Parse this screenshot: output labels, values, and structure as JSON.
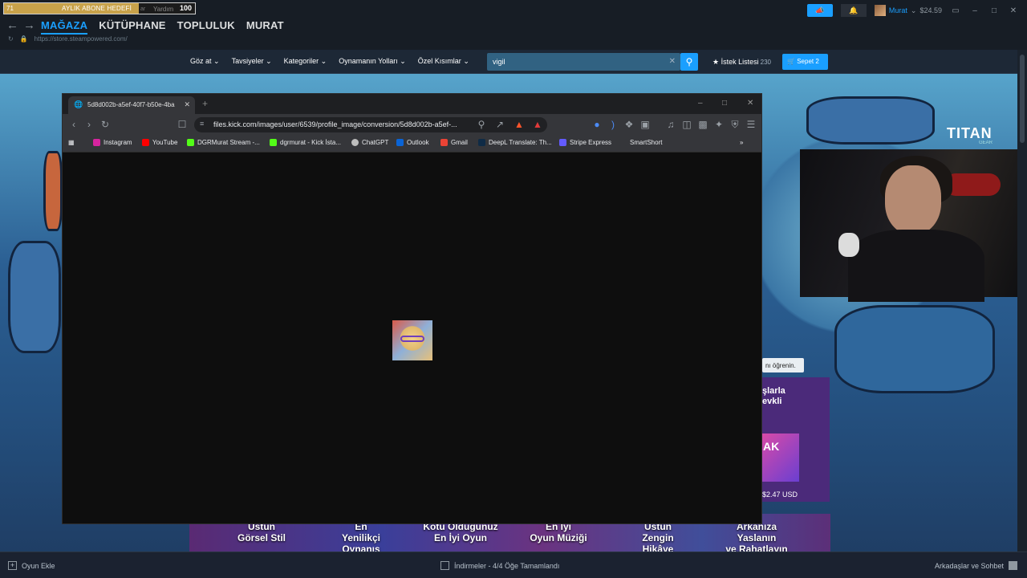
{
  "overlay": {
    "goal_left": "71",
    "goal_label": "AYLIK ABONE HEDEFİ",
    "goal_right": "100",
    "goal_ghost_left": "ar",
    "goal_ghost_right": "Yardım"
  },
  "steam": {
    "nav": [
      "MAĞAZA",
      "KÜTÜPHANE",
      "TOPLULUK",
      "MURAT"
    ],
    "url": "https://store.steampowered.com/",
    "user_name": "Murat",
    "wallet": "$24.59"
  },
  "store_nav": {
    "items": [
      "Göz at",
      "Tavsiyeler",
      "Kategoriler",
      "Oynamanın Yolları",
      "Özel Kısımlar"
    ],
    "search_value": "vigil",
    "wishlist_label": "İstek Listesi",
    "wishlist_count": "230",
    "cart_label": "Sepet",
    "cart_count": "2"
  },
  "store_content": {
    "titan_brand": "TITAN",
    "titan_sub": "GEAR",
    "learn_more": "nı öğrenin.",
    "promo_title_line1": "şlarla",
    "promo_title_line2": "evkli",
    "promo_image_text": "AK",
    "promo_price": "$2.47 USD",
    "awards": [
      {
        "line1": "Üstün",
        "line2": "Görsel Stil",
        "line3": ""
      },
      {
        "line1": "En",
        "line2": "Yenilikçi",
        "line3": "Oynanış"
      },
      {
        "line1": "Kötü Olduğunuz",
        "line2": "En İyi Oyun",
        "line3": ""
      },
      {
        "line1": "En İyi",
        "line2": "Oyun Müziği",
        "line3": ""
      },
      {
        "line1": "Üstün",
        "line2": "Zengin",
        "line3": "Hikâye"
      },
      {
        "line1": "Arkanıza",
        "line2": "Yaslanın",
        "line3": "ve Rahatlayın"
      }
    ]
  },
  "browser": {
    "tab_title": "5d8d002b-a5ef-40f7-b50e-4ba",
    "address": "files.kick.com/images/user/6539/profile_image/conversion/5d8d002b-a5ef-...",
    "bookmarks": [
      {
        "label": "Instagram",
        "color": "#d6249f"
      },
      {
        "label": "YouTube",
        "color": "#ff0000"
      },
      {
        "label": "DGRMurat Stream -...",
        "color": "#53fc18"
      },
      {
        "label": "dgrmurat - Kick İsta...",
        "color": "#53fc18"
      },
      {
        "label": "ChatGPT",
        "color": "#bdbdbd"
      },
      {
        "label": "Outlook",
        "color": "#0a64d6"
      },
      {
        "label": "Gmail",
        "color": "#ea4335"
      },
      {
        "label": "DeepL Translate: Th...",
        "color": "#0f2b46"
      },
      {
        "label": "Stripe Express",
        "color": "#635bff"
      },
      {
        "label": "SmartShort",
        "color": "#35363a"
      }
    ]
  },
  "bottom_bar": {
    "add_game": "Oyun Ekle",
    "downloads": "İndirmeler - 4/4 Öğe Tamamlandı",
    "friends": "Arkadaşlar ve Sohbet"
  }
}
